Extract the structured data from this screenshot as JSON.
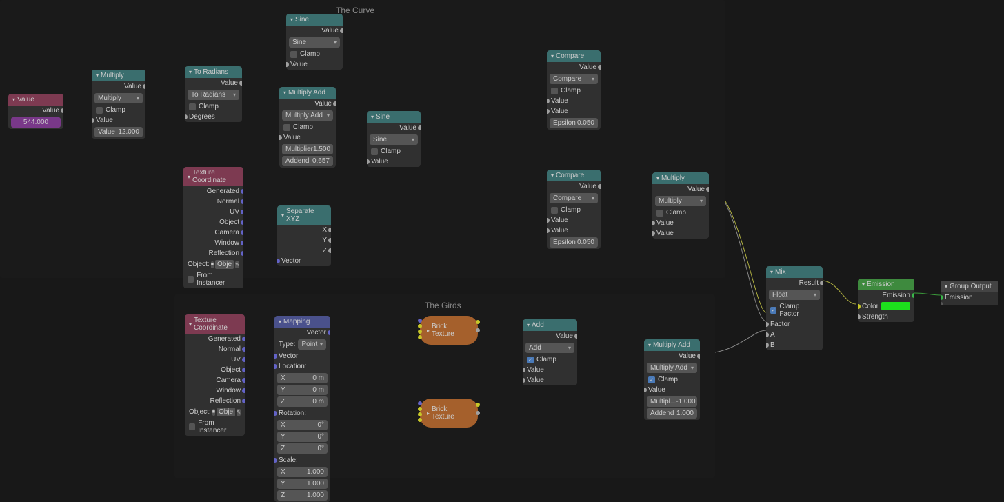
{
  "frames": {
    "curve": "The Curve",
    "girds": "The Girds"
  },
  "nodes": {
    "value": {
      "title": "Value",
      "out": "Value",
      "val": "544.000"
    },
    "multiply": {
      "title": "Multiply",
      "out": "Value",
      "dd": "Multiply",
      "clamp": "Clamp",
      "in1": "Value",
      "in2_l": "Value",
      "in2_v": "12.000"
    },
    "toRad": {
      "title": "To Radians",
      "out": "Value",
      "dd": "To Radians",
      "clamp": "Clamp",
      "in": "Degrees"
    },
    "sine1": {
      "title": "Sine",
      "out": "Value",
      "dd": "Sine",
      "clamp": "Clamp",
      "in": "Value"
    },
    "multAdd1": {
      "title": "Multiply Add",
      "out": "Value",
      "dd": "Multiply Add",
      "clamp": "Clamp",
      "in": "Value",
      "mul_l": "Multiplier",
      "mul_v": "1.500",
      "add_l": "Addend",
      "add_v": "0.657"
    },
    "sine2": {
      "title": "Sine",
      "out": "Value",
      "dd": "Sine",
      "clamp": "Clamp",
      "in": "Value"
    },
    "texCoord1": {
      "title": "Texture Coordinate",
      "o": [
        "Generated",
        "Normal",
        "UV",
        "Object",
        "Camera",
        "Window",
        "Reflection"
      ],
      "obj_l": "Object:",
      "obj_v": "Obje",
      "fi": "From Instancer"
    },
    "sepXYZ": {
      "title": "Separate XYZ",
      "x": "X",
      "y": "Y",
      "z": "Z",
      "in": "Vector"
    },
    "compare1": {
      "title": "Compare",
      "out": "Value",
      "dd": "Compare",
      "clamp": "Clamp",
      "in1": "Value",
      "in2": "Value",
      "eps_l": "Epsilon",
      "eps_v": "0.050"
    },
    "compare2": {
      "title": "Compare",
      "out": "Value",
      "dd": "Compare",
      "clamp": "Clamp",
      "in1": "Value",
      "in2": "Value",
      "eps_l": "Epsilon",
      "eps_v": "0.050"
    },
    "multiply2": {
      "title": "Multiply",
      "out": "Value",
      "dd": "Multiply",
      "clamp": "Clamp",
      "in1": "Value",
      "in2": "Value"
    },
    "texCoord2": {
      "title": "Texture Coordinate",
      "o": [
        "Generated",
        "Normal",
        "UV",
        "Object",
        "Camera",
        "Window",
        "Reflection"
      ],
      "obj_l": "Object:",
      "obj_v": "Obje",
      "fi": "From Instancer"
    },
    "mapping": {
      "title": "Mapping",
      "out": "Vector",
      "type_l": "Type:",
      "type_v": "Point",
      "in": "Vector",
      "loc": "Location:",
      "rot": "Rotation:",
      "scale": "Scale:",
      "x": "X",
      "y": "Y",
      "z": "Z",
      "m0": "0 m",
      "d0": "0°",
      "s1": "1.000"
    },
    "brick1": "Brick Texture",
    "brick2": "Brick Texture",
    "add": {
      "title": "Add",
      "out": "Value",
      "dd": "Add",
      "clamp": "Clamp",
      "in1": "Value",
      "in2": "Value"
    },
    "multAdd2": {
      "title": "Multiply Add",
      "out": "Value",
      "dd": "Multiply Add",
      "clamp": "Clamp",
      "in": "Value",
      "mul_l": "Multipl...",
      "mul_v": "-1.000",
      "add_l": "Addend",
      "add_v": "1.000"
    },
    "mix": {
      "title": "Mix",
      "out": "Result",
      "dd": "Float",
      "cf": "Clamp Factor",
      "fac": "Factor",
      "a": "A",
      "b": "B"
    },
    "emission": {
      "title": "Emission",
      "out": "Emission",
      "color": "Color",
      "strength": "Strength"
    },
    "groupOut": {
      "title": "Group Output",
      "in": "Emission"
    }
  }
}
